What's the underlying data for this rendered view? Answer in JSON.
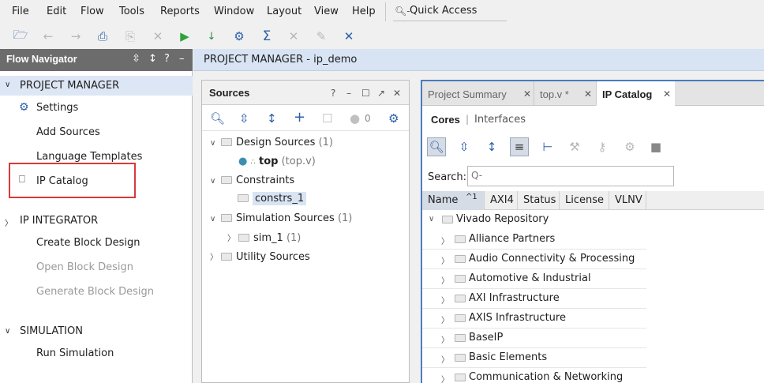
{
  "menu": [
    "File",
    "Edit",
    "Flow",
    "Tools",
    "Reports",
    "Window",
    "Layout",
    "View",
    "Help"
  ],
  "quick_access": {
    "label": "Quick Access",
    "icon": "search-icon"
  },
  "toolbar_icons": [
    "open-folder-icon",
    "undo-icon",
    "redo-icon",
    "copy-icon",
    "paste-icon",
    "delete-icon",
    "run-icon",
    "program-download-icon",
    "settings-icon",
    "sigma-icon",
    "cancel-icon",
    "pencil-icon",
    "wrench-icon"
  ],
  "flow_navigator": {
    "title": "Flow Navigator",
    "sections": [
      {
        "title": "PROJECT MANAGER",
        "items": [
          "Settings",
          "Add Sources",
          "Language Templates",
          "IP Catalog"
        ]
      },
      {
        "title": "IP INTEGRATOR",
        "items": [
          "Create Block Design",
          "Open Block Design",
          "Generate Block Design"
        ]
      },
      {
        "title": "SIMULATION",
        "items": [
          "Run Simulation"
        ]
      }
    ]
  },
  "project_header": "PROJECT MANAGER - ip_demo",
  "sources": {
    "title": "Sources",
    "status_count": "0",
    "tree": {
      "design_sources": "Design Sources",
      "design_sources_count": "(1)",
      "top": "top",
      "top_file": "(top.v)",
      "constraints": "Constraints",
      "constrs": "constrs_1",
      "sim_sources": "Simulation Sources",
      "sim_sources_count": "(1)",
      "sim_1": "sim_1",
      "sim_1_count": "(1)",
      "utility": "Utility Sources"
    }
  },
  "ip_panel": {
    "tabs": [
      "Project Summary",
      "top.v *",
      "IP Catalog"
    ],
    "subtabs": {
      "cores": "Cores",
      "sep": "|",
      "interfaces": "Interfaces"
    },
    "search_label": "Search:",
    "search_placeholder": "Q-",
    "columns": [
      "Name",
      "AXI4",
      "Status",
      "License",
      "VLNV"
    ],
    "sort_indicator": "^1",
    "root": "Vivado Repository",
    "categories": [
      "Alliance Partners",
      "Audio Connectivity & Processing",
      "Automotive & Industrial",
      "AXI Infrastructure",
      "AXIS Infrastructure",
      "BaseIP",
      "Basic Elements",
      "Communication & Networking"
    ]
  },
  "colors": {
    "header_bg": "#6c6c6c",
    "selection_bg": "#dde6f4",
    "highlight_box": "#d93a3a",
    "accent": "#4a7cc1"
  }
}
